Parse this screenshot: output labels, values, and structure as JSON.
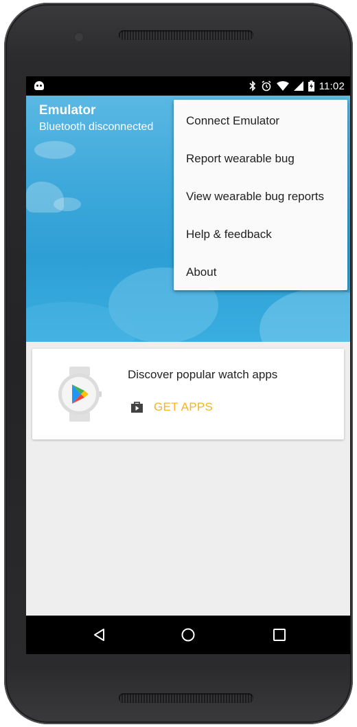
{
  "status_bar": {
    "time": "11:02",
    "icons": [
      "android-notification-icon",
      "bluetooth-icon",
      "alarm-icon",
      "wifi-icon",
      "signal-icon",
      "battery-charging-icon"
    ]
  },
  "header": {
    "title": "Emulator",
    "subtitle": "Bluetooth disconnected"
  },
  "overflow_menu": {
    "items": [
      {
        "label": "Connect Emulator"
      },
      {
        "label": "Report wearable bug"
      },
      {
        "label": "View wearable bug reports"
      },
      {
        "label": "Help & feedback"
      },
      {
        "label": "About"
      }
    ]
  },
  "card": {
    "title": "Discover popular watch apps",
    "button_label": "GET APPS",
    "button_color": "#f5b51e",
    "icon": "play-store-watch-icon"
  },
  "nav_bar": {
    "buttons": [
      "back-icon",
      "home-icon",
      "recents-icon"
    ]
  },
  "colors": {
    "hero_blue": "#3fa9db",
    "accent": "#f5b51e"
  }
}
